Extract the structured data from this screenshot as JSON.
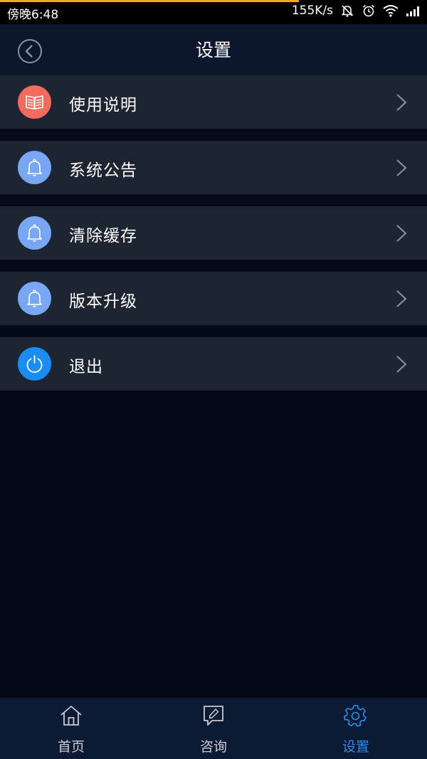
{
  "status_bar": {
    "time": "傍晚6:48",
    "net_speed": "155K/s"
  },
  "header": {
    "title": "设置"
  },
  "settings": {
    "items": [
      {
        "label": "使用说明",
        "icon": "book-icon",
        "color": "#f36b5a"
      },
      {
        "label": "系统公告",
        "icon": "bell-icon",
        "color": "#7aa7f5"
      },
      {
        "label": "清除缓存",
        "icon": "bell-icon",
        "color": "#7aa7f5"
      },
      {
        "label": "版本升级",
        "icon": "bell-icon",
        "color": "#7aa7f5"
      },
      {
        "label": "退出",
        "icon": "power-icon",
        "color": "#1b8df2"
      }
    ]
  },
  "nav": {
    "items": [
      {
        "label": "首页",
        "icon": "home-icon"
      },
      {
        "label": "咨询",
        "icon": "chat-pen-icon"
      },
      {
        "label": "设置",
        "icon": "gear-icon"
      }
    ],
    "active_index": 2,
    "active_color": "#2b8cf0"
  }
}
